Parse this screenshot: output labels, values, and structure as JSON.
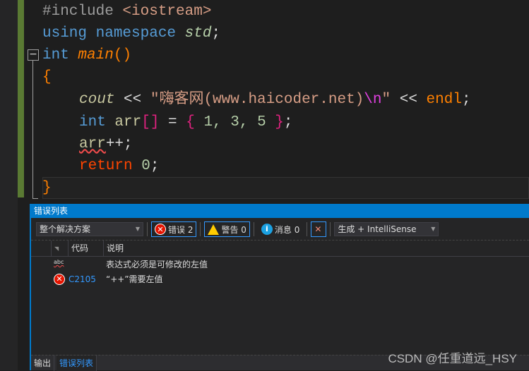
{
  "code": {
    "l1": {
      "a": "#include ",
      "b": "<iostream>"
    },
    "l2": {
      "a": "using namespace ",
      "b": "std",
      ";": ";"
    },
    "l3": {
      "a": "int ",
      "b": "main",
      "c": "()",
      "fold": "−"
    },
    "l4": "{",
    "l5": {
      "a": "cout",
      "b": " << ",
      "c": "\"嗨客网(www.haicoder.net)",
      "d": "\\n",
      "e": "\"",
      "f": " << ",
      "g": "endl",
      ";": ";"
    },
    "l6": {
      "a": "int ",
      "b": "arr",
      "c": "[]",
      "d": " = ",
      "e": "{",
      "f": " 1, 3, 5 ",
      "g": "}",
      ";": ";"
    },
    "l7": {
      "a": "arr",
      "b": "++;"
    },
    "l8": {
      "a": "return ",
      "b": "0",
      ";": ";"
    },
    "l9": "}"
  },
  "panel": {
    "title": "错误列表",
    "scope": "整个解决方案",
    "errors": "错误 2",
    "warnings": "警告 0",
    "messages": "消息 0",
    "source": "生成 + IntelliSense",
    "columns": {
      "code": "代码",
      "desc": "说明"
    },
    "rows": [
      {
        "icon": "spell-squiggle-icon",
        "icon_text": "abc",
        "code": "",
        "desc": "表达式必须是可修改的左值"
      },
      {
        "icon": "error-icon",
        "code": "C2105",
        "desc": "“++”需要左值"
      }
    ],
    "tabs": [
      "输出",
      "错误列表"
    ]
  },
  "watermark": "CSDN @任重道远_HSY",
  "colors": {
    "accent": "#007acc",
    "error": "#e51400",
    "warning": "#ffcc00",
    "link": "#3399ff"
  }
}
